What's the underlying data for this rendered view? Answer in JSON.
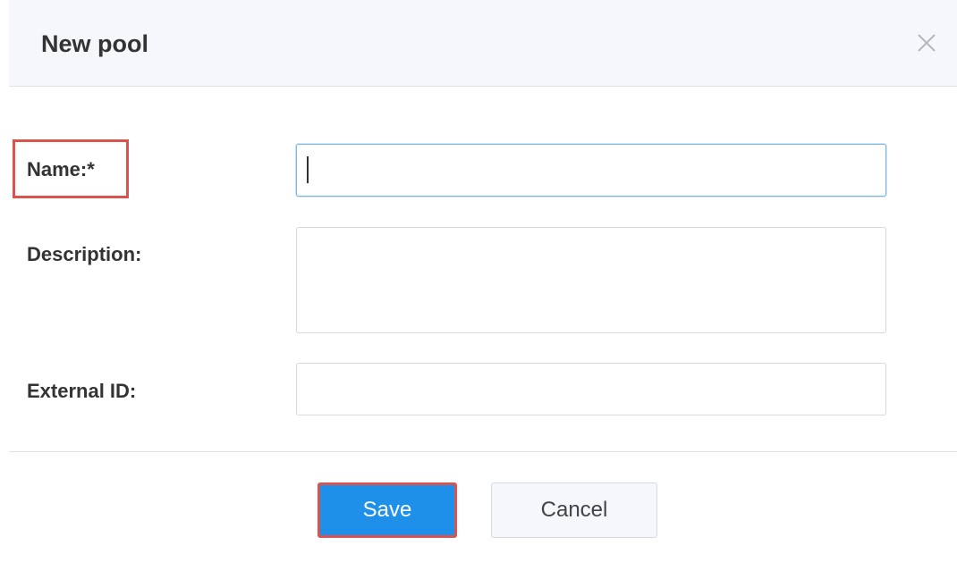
{
  "dialog": {
    "title": "New pool",
    "close_icon": "close-icon"
  },
  "form": {
    "name": {
      "label": "Name:*",
      "value": "",
      "placeholder": ""
    },
    "description": {
      "label": "Description:",
      "value": "",
      "placeholder": ""
    },
    "external_id": {
      "label": "External ID:",
      "value": "",
      "placeholder": ""
    }
  },
  "footer": {
    "save_label": "Save",
    "cancel_label": "Cancel"
  },
  "colors": {
    "primary": "#1e90ea",
    "highlight": "#d9534f",
    "focus_border": "#7ab8e0"
  }
}
